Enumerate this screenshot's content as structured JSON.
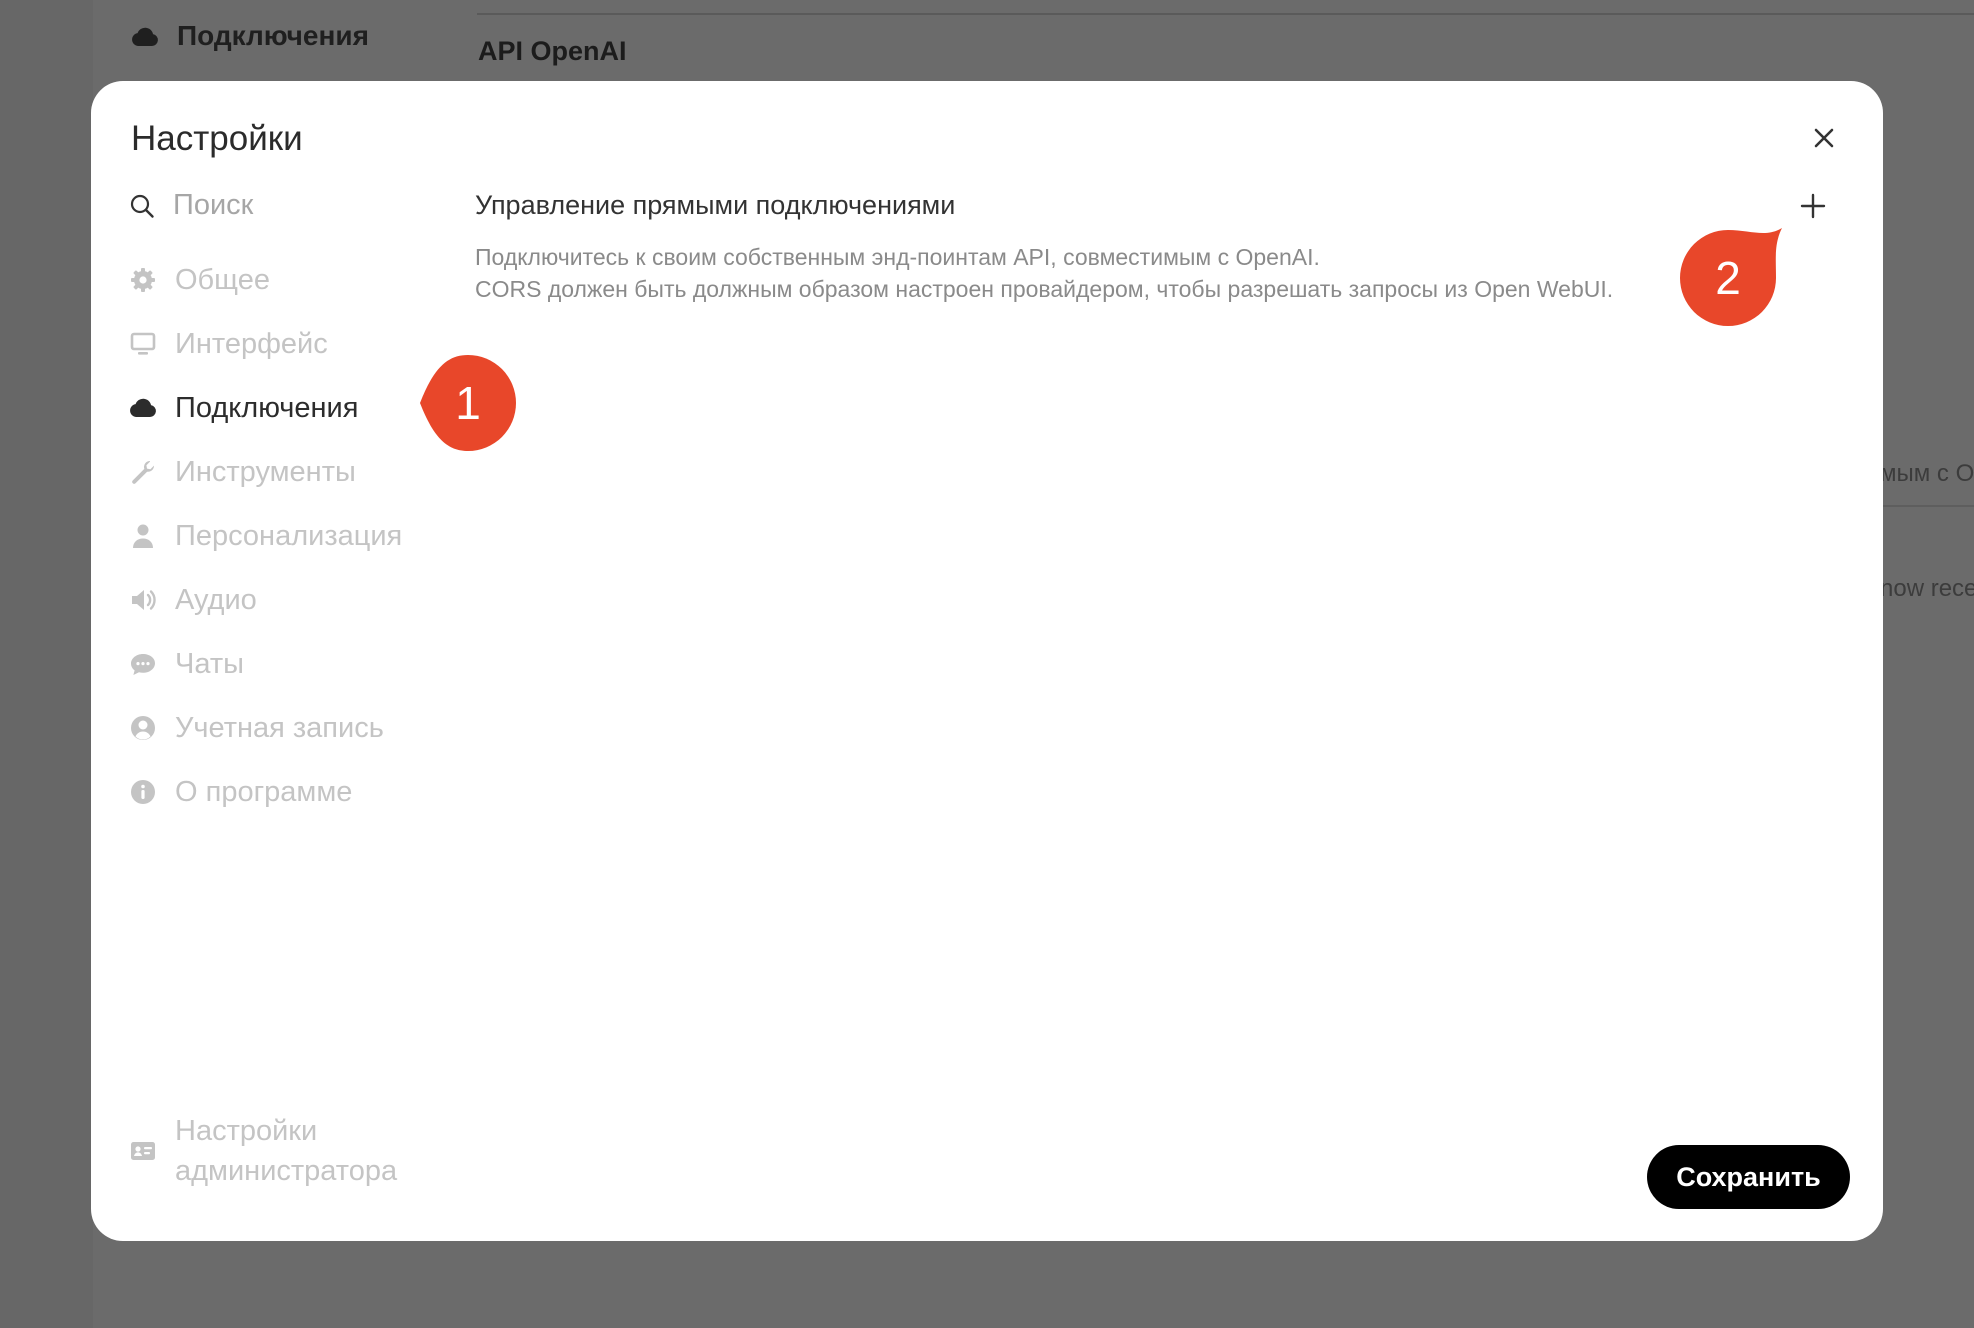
{
  "background": {
    "nav_item": "Подключения",
    "heading": "API OpenAI",
    "partial_text_1": "мым с О",
    "partial_text_2": "now rece"
  },
  "modal": {
    "title": "Настройки",
    "search": {
      "placeholder": "Поиск"
    },
    "nav": [
      {
        "label": "Общее",
        "icon": "gear-icon",
        "active": false
      },
      {
        "label": "Интерфейс",
        "icon": "monitor-icon",
        "active": false
      },
      {
        "label": "Подключения",
        "icon": "cloud-icon",
        "active": true
      },
      {
        "label": "Инструменты",
        "icon": "wrench-icon",
        "active": false
      },
      {
        "label": "Персонализация",
        "icon": "user-icon",
        "active": false
      },
      {
        "label": "Аудио",
        "icon": "speaker-icon",
        "active": false
      },
      {
        "label": "Чаты",
        "icon": "chat-bubble-icon",
        "active": false
      },
      {
        "label": "Учетная запись",
        "icon": "account-circle-icon",
        "active": false
      },
      {
        "label": "О программе",
        "icon": "info-icon",
        "active": false
      }
    ],
    "admin_label": "Настройки администратора",
    "section_title": "Управление прямыми подключениями",
    "description_line1": "Подключитесь к своим собственным энд-поинтам API, совместимым с OpenAI.",
    "description_line2": "CORS должен быть должным образом настроен провайдером, чтобы разрешать запросы из Open WebUI.",
    "save_label": "Сохранить"
  },
  "markers": [
    {
      "label": "1"
    },
    {
      "label": "2"
    }
  ],
  "colors": {
    "marker": "#e8472a",
    "overlay": "#696969",
    "save_button": "#000000"
  }
}
